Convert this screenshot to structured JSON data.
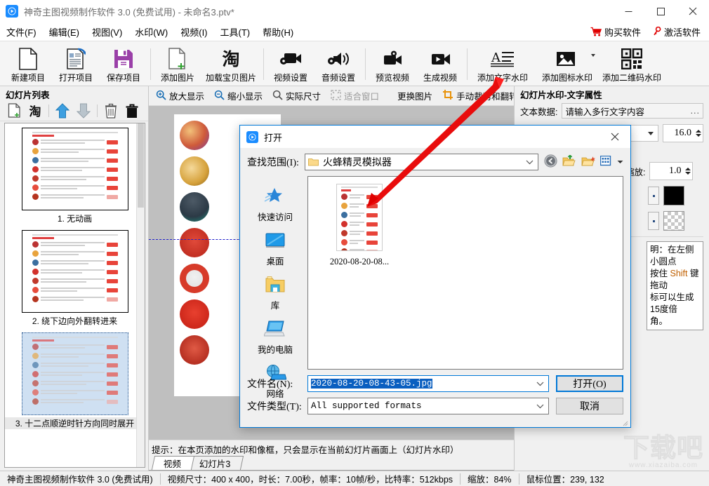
{
  "window": {
    "title": "神奇主图视频制作软件 3.0 (免费试用) - 未命名3.ptv*",
    "app_icon": "app-logo-icon",
    "minimize": "—",
    "maximize": "□",
    "close": "✕"
  },
  "menubar": {
    "items": [
      {
        "label": "文件(F)"
      },
      {
        "label": "编辑(E)"
      },
      {
        "label": "视图(V)"
      },
      {
        "label": "水印(W)"
      },
      {
        "label": "视频(I)"
      },
      {
        "label": "工具(T)"
      },
      {
        "label": "帮助(H)"
      }
    ],
    "buy_label": "购买软件",
    "activate_label": "激活软件"
  },
  "toolbar": {
    "buttons": [
      {
        "label": "新建项目",
        "icon": "new-document-icon"
      },
      {
        "label": "打开项目",
        "icon": "open-project-icon"
      },
      {
        "label": "保存项目",
        "icon": "save-disk-icon"
      },
      {
        "label": "添加图片",
        "icon": "add-image-icon"
      },
      {
        "label": "加载宝贝图片",
        "icon": "taobao-icon"
      },
      {
        "label": "视频设置",
        "icon": "video-settings-icon"
      },
      {
        "label": "音频设置",
        "icon": "audio-settings-icon"
      },
      {
        "label": "预览视频",
        "icon": "preview-video-icon"
      },
      {
        "label": "生成视频",
        "icon": "render-video-icon"
      },
      {
        "label": "添加文字水印",
        "icon": "text-watermark-icon"
      },
      {
        "label": "添加图标水印",
        "icon": "image-watermark-icon"
      },
      {
        "label": "添加二维码水印",
        "icon": "qrcode-watermark-icon"
      }
    ]
  },
  "left_panel": {
    "title": "幻灯片列表",
    "tools": [
      {
        "name": "add-slide",
        "icon": "add-page-icon"
      },
      {
        "name": "load-taobao",
        "icon": "taobao-icon"
      },
      {
        "name": "move-up",
        "icon": "arrow-up-icon"
      },
      {
        "name": "move-down",
        "icon": "arrow-down-icon"
      },
      {
        "name": "delete-slide",
        "icon": "trash-icon"
      },
      {
        "name": "clear-all",
        "icon": "clear-all-icon"
      }
    ],
    "slides": [
      {
        "caption": "1. 无动画",
        "selected": false
      },
      {
        "caption": "2. 绕下边向外翻转进来",
        "selected": false
      },
      {
        "caption": "3. 十二点顺逆时针方向同时展开",
        "selected": true
      }
    ]
  },
  "canvas_toolbar": {
    "buttons": [
      {
        "label": "放大显示",
        "icon": "zoom-in-icon",
        "disabled": false
      },
      {
        "label": "缩小显示",
        "icon": "zoom-out-icon",
        "disabled": false
      },
      {
        "label": "实际尺寸",
        "icon": "actual-size-icon",
        "disabled": false
      },
      {
        "label": "适合窗口",
        "icon": "fit-window-icon",
        "disabled": true
      },
      {
        "label": "更换图片",
        "icon": "replace-image-icon",
        "disabled": false
      },
      {
        "label": "手动裁剪和翻转",
        "icon": "crop-flip-icon",
        "disabled": false
      }
    ]
  },
  "tip": {
    "text": "提示：在本页添加的水印和像框，只会显示在当前幻灯片画面上（幻灯片水印）"
  },
  "tabs": [
    {
      "label": "视频",
      "active": true
    },
    {
      "label": "幻灯片3",
      "active": false
    }
  ],
  "right_panel": {
    "title": "幻灯片水印-文字属性",
    "text_data_label": "文本数据:",
    "text_data_value": "请输入多行文字内容",
    "text_data_more": "...",
    "font_size_value": "16.0",
    "scale_label": "缩放:",
    "scale_value": "1.0",
    "color_swatch": "#000000",
    "transparent_swatch": "transparent-checker",
    "note": "明：在左侧小圆点\n按住 Shift 键拖动\n标可以生成15度倍\n角。",
    "note_highlight": "Shift"
  },
  "dialog": {
    "title": "打开",
    "icon": "app-logo-icon",
    "close": "✕",
    "look_in_label": "查找范围(I):",
    "look_in_value": "火蜂精灵模拟器",
    "nav_buttons": [
      {
        "name": "back-button",
        "icon": "back-arrow-icon"
      },
      {
        "name": "up-one-level-button",
        "icon": "up-folder-icon"
      },
      {
        "name": "new-folder-button",
        "icon": "new-folder-icon"
      },
      {
        "name": "view-mode-button",
        "icon": "view-grid-icon"
      }
    ],
    "places": [
      {
        "label": "快速访问",
        "icon": "quick-access-star-icon"
      },
      {
        "label": "桌面",
        "icon": "desktop-icon"
      },
      {
        "label": "库",
        "icon": "library-folder-icon"
      },
      {
        "label": "我的电脑",
        "icon": "my-computer-icon"
      },
      {
        "label": "网络",
        "icon": "network-icon"
      }
    ],
    "files": [
      {
        "name": "2020-08-20-08...",
        "thumb": "image-thumbnail"
      }
    ],
    "filename_label": "文件名(N):",
    "filename_value": "2020-08-20-08-43-05.jpg",
    "filetype_label": "文件类型(T):",
    "filetype_value": "All supported formats",
    "open_button": "打开(O)",
    "cancel_button": "取消"
  },
  "statusbar": {
    "app": "神奇主图视频制作软件 3.0 (免费试用)",
    "video_info": "视频尺寸：400 x 400，时长：7.00秒，帧率：10帧/秒，比特率：512kbps",
    "zoom": "缩放：84%",
    "mouse": "鼠标位置：239, 132"
  },
  "watermark": {
    "big": "下载吧",
    "small": "www.xiazaiba.com"
  },
  "colors": {
    "accent": "#0078d7",
    "title_blue": "#1a8cff",
    "red": "#e00000",
    "canvas_gray": "#bfbfbf"
  }
}
